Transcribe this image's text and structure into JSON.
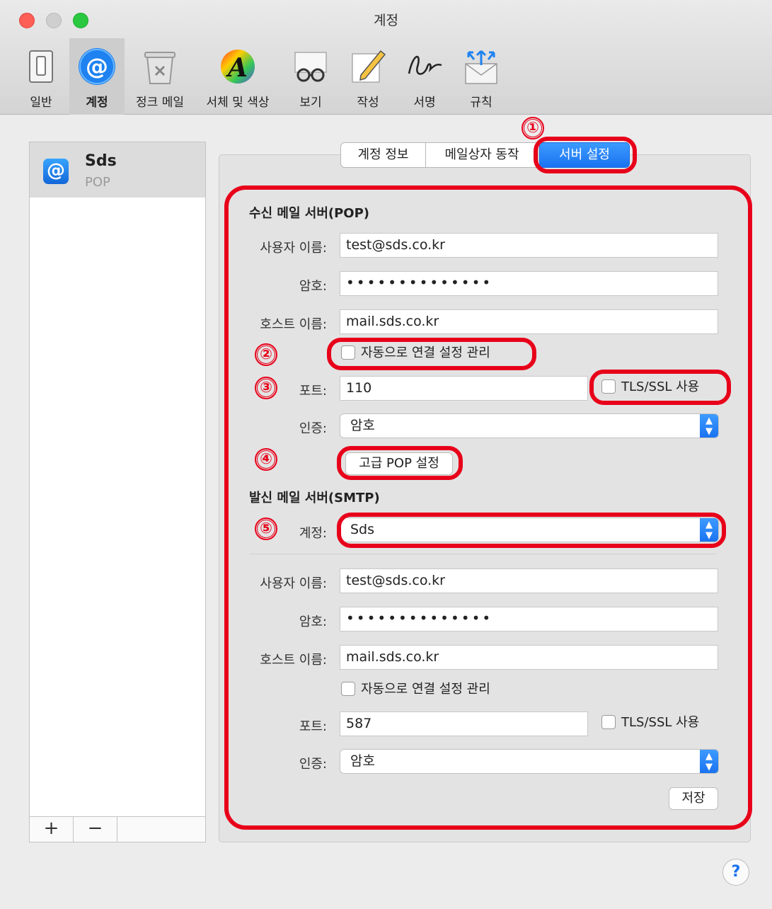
{
  "window": {
    "title": "계정"
  },
  "toolbar": {
    "items": [
      {
        "label": "일반",
        "icon": "general-switch-icon"
      },
      {
        "label": "계정",
        "icon": "at-sign-icon",
        "selected": true
      },
      {
        "label": "정크 메일",
        "icon": "junk-trash-icon"
      },
      {
        "label": "서체 및 색상",
        "icon": "font-color-icon"
      },
      {
        "label": "보기",
        "icon": "glasses-icon"
      },
      {
        "label": "작성",
        "icon": "pencil-compose-icon"
      },
      {
        "label": "서명",
        "icon": "signature-icon"
      },
      {
        "label": "규칙",
        "icon": "rules-envelope-icon"
      }
    ]
  },
  "sidebar": {
    "accounts": [
      {
        "name": "Sds",
        "type": "POP"
      }
    ],
    "add_label": "+",
    "remove_label": "−"
  },
  "tabs": [
    {
      "label": "계정 정보",
      "selected": false
    },
    {
      "label": "메일상자 동작",
      "selected": false
    },
    {
      "label": "서버 설정",
      "selected": true
    }
  ],
  "annotations": {
    "n1": "①",
    "n2": "②",
    "n3": "③",
    "n4": "④",
    "n5": "⑤"
  },
  "incoming": {
    "heading": "수신 메일 서버(POP)",
    "username_label": "사용자 이름:",
    "username": "test@sds.co.kr",
    "password_label": "암호:",
    "password": "••••••••••••••",
    "host_label": "호스트 이름:",
    "host": "mail.sds.co.kr",
    "auto_manage_label": "자동으로 연결 설정 관리",
    "auto_manage": false,
    "port_label": "포트:",
    "port": "110",
    "tls_label": "TLS/SSL 사용",
    "tls": false,
    "auth_label": "인증:",
    "auth": "암호",
    "advanced_button": "고급 POP 설정"
  },
  "outgoing": {
    "heading": "발신 메일 서버(SMTP)",
    "account_label": "계정:",
    "account": "Sds",
    "username_label": "사용자 이름:",
    "username": "test@sds.co.kr",
    "password_label": "암호:",
    "password": "••••••••••••••",
    "host_label": "호스트 이름:",
    "host": "mail.sds.co.kr",
    "auto_manage_label": "자동으로 연결 설정 관리",
    "auto_manage": false,
    "port_label": "포트:",
    "port": "587",
    "tls_label": "TLS/SSL 사용",
    "tls": false,
    "auth_label": "인증:",
    "auth": "암호"
  },
  "save_button": "저장",
  "help_label": "?",
  "colors": {
    "highlight": "#e8001a",
    "accent": "#1a73f0"
  }
}
